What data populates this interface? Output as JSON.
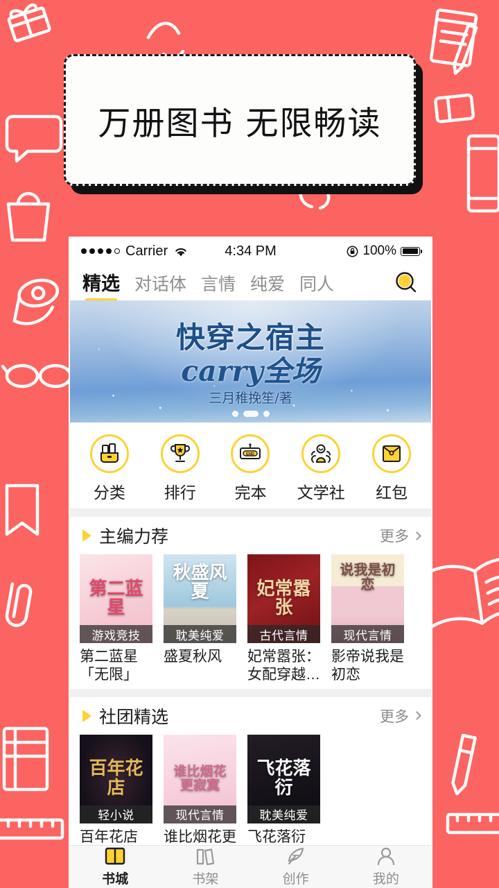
{
  "promo": {
    "text": "万册图书  无限畅读"
  },
  "statusbar": {
    "carrier": "Carrier",
    "time": "4:34 PM",
    "battery_percent": "100%",
    "signal_dots": 5,
    "wifi_icon": "wifi-icon",
    "lock_icon": "rotation-lock-icon",
    "battery_icon": "battery-full-icon"
  },
  "tabs": [
    {
      "label": "精选",
      "active": true
    },
    {
      "label": "对话体",
      "active": false
    },
    {
      "label": "言情",
      "active": false
    },
    {
      "label": "纯爱",
      "active": false
    },
    {
      "label": "同人",
      "active": false
    }
  ],
  "search": {
    "icon": "search-icon"
  },
  "hero": {
    "title": "快穿之宿主",
    "subtitle": "carry全场",
    "author": "三月稚挽笙/著",
    "dots_total": 3,
    "dots_active_index": 1
  },
  "quick_actions": [
    {
      "label": "分类",
      "icon": "books-icon"
    },
    {
      "label": "排行",
      "icon": "trophy-icon"
    },
    {
      "label": "完本",
      "icon": "end-sign-icon"
    },
    {
      "label": "文学社",
      "icon": "people-group-icon"
    },
    {
      "label": "红包",
      "icon": "red-envelope-icon"
    }
  ],
  "sections": [
    {
      "title": "主编力荐",
      "more_label": "更多",
      "books": [
        {
          "name": "第二蓝星「无限」",
          "cover_title": "第二蓝星",
          "badge": "游戏竞技",
          "cover_bg": "#f6cfd3",
          "cover_fg": "#e2496b"
        },
        {
          "name": "盛夏秋风",
          "cover_title": "秋盛风夏",
          "badge": "耽美纯爱",
          "cover_bg": "#a9cfe2",
          "cover_fg": "#ffffff"
        },
        {
          "name": "妃常嚣张：女配穿越…",
          "cover_title": "妃常嚣张",
          "badge": "古代言情",
          "cover_bg": "#8c1a1f",
          "cover_fg": "#f4d9a8"
        },
        {
          "name": "影帝说我是初恋",
          "cover_title": "说我是初恋",
          "badge": "现代言情",
          "cover_bg": "#f2e3c8",
          "cover_fg": "#8a5a4a"
        }
      ]
    },
    {
      "title": "社团精选",
      "more_label": "更多",
      "books": [
        {
          "name": "百年花店",
          "cover_title": "百年花店",
          "badge": "轻小说",
          "cover_bg": "#171014",
          "cover_fg": "#e0b860"
        },
        {
          "name": "谁比烟花更",
          "cover_title": "谁比烟花更寂寞",
          "badge": "现代言情",
          "cover_bg": "#f8dbe3",
          "cover_fg": "#d06a8c"
        },
        {
          "name": "飞花落衍",
          "cover_title": "飞花落衍",
          "badge": "耽美纯爱",
          "cover_bg": "#16131a",
          "cover_fg": "#ffffff"
        }
      ]
    }
  ],
  "bottom_nav": [
    {
      "label": "书城",
      "icon": "bookstore-icon",
      "active": true
    },
    {
      "label": "书架",
      "icon": "bookshelf-icon",
      "active": false
    },
    {
      "label": "创作",
      "icon": "quill-pen-icon",
      "active": false
    },
    {
      "label": "我的",
      "icon": "person-icon",
      "active": false
    }
  ],
  "colors": {
    "background": "#fb6461",
    "accent_yellow": "#ffd133",
    "text_primary": "#1c1c1c",
    "text_muted": "#8d8d8d"
  }
}
